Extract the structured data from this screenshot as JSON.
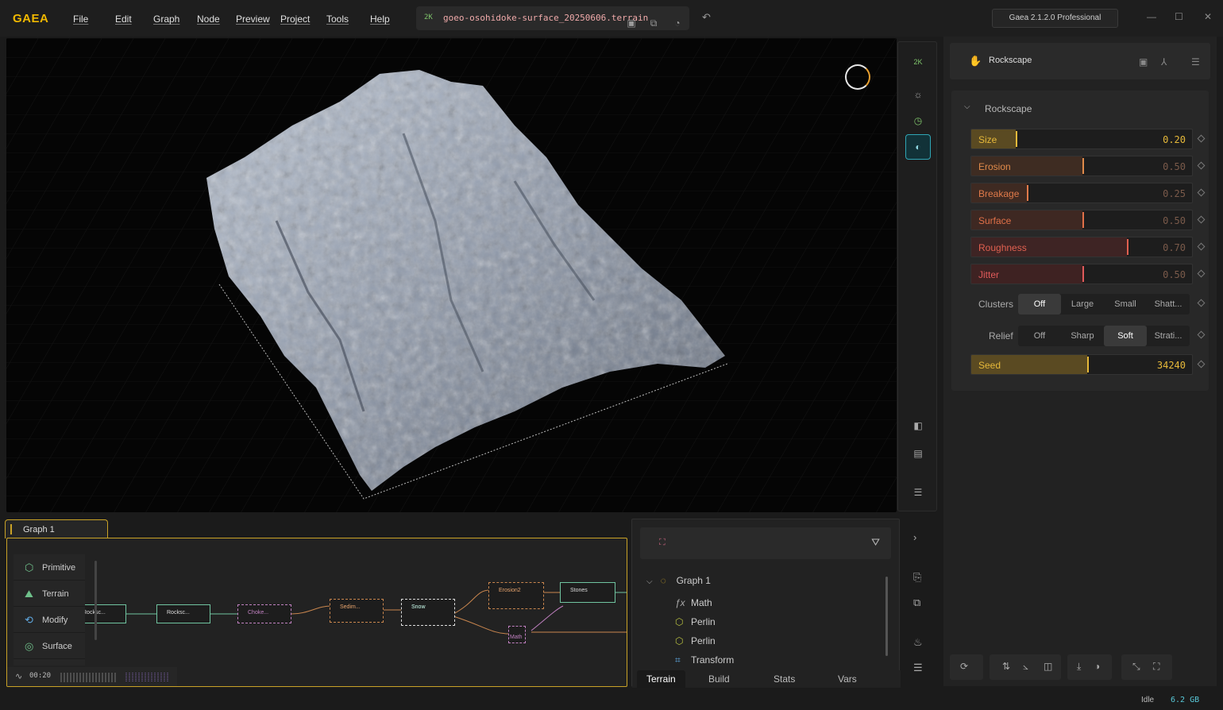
{
  "app": {
    "logo": "GAEA",
    "version": "Gaea 2.1.2.0 Professional"
  },
  "menu": [
    "File",
    "Edit",
    "Graph",
    "Node",
    "Preview",
    "Project",
    "Tools",
    "Help"
  ],
  "file": {
    "resolution": "2K",
    "name": "goeo-osohidoke-surface_20250606.terrain"
  },
  "viewport_tools": {
    "resolution_badge": "2K"
  },
  "properties": {
    "node_name": "Rockscape",
    "section_title": "Rockscape",
    "sliders": [
      {
        "label": "Size",
        "value": "0.20",
        "fraction": 0.2,
        "color": "#e6b93a",
        "fill": "#5a4a22"
      },
      {
        "label": "Erosion",
        "value": "0.50",
        "fraction": 0.5,
        "color": "#e08a4a",
        "fill": "#3e2c22"
      },
      {
        "label": "Breakage",
        "value": "0.25",
        "fraction": 0.25,
        "color": "#e07a4a",
        "fill": "#3e2a22"
      },
      {
        "label": "Surface",
        "value": "0.50",
        "fraction": 0.5,
        "color": "#e07048",
        "fill": "#3e2822"
      },
      {
        "label": "Roughness",
        "value": "0.70",
        "fraction": 0.7,
        "color": "#e06050",
        "fill": "#3e2424"
      },
      {
        "label": "Jitter",
        "value": "0.50",
        "fraction": 0.5,
        "color": "#e05a5a",
        "fill": "#3e2222"
      }
    ],
    "clusters": {
      "label": "Clusters",
      "options": [
        "Off",
        "Large",
        "Small",
        "Shatt..."
      ],
      "selected": "Off"
    },
    "relief": {
      "label": "Relief",
      "options": [
        "Off",
        "Sharp",
        "Soft",
        "Strati..."
      ],
      "selected": "Soft"
    },
    "seed": {
      "label": "Seed",
      "value": "34240",
      "fraction": 0.52,
      "color": "#e6b93a",
      "fill": "#5a4a22"
    }
  },
  "graph": {
    "tab": "Graph 1",
    "palette": [
      {
        "label": "Primitive",
        "icon": "cube-icon"
      },
      {
        "label": "Terrain",
        "icon": "mountain-icon"
      },
      {
        "label": "Modify",
        "icon": "refresh-icon"
      },
      {
        "label": "Surface",
        "icon": "surface-icon"
      }
    ],
    "timer": "00:20",
    "nodes": [
      "Rocksc...",
      "Rocksc...",
      "Choke...",
      "Sedim...",
      "Snow",
      "Erosion2",
      "Stones",
      "Math"
    ]
  },
  "explorer": {
    "root": "Graph 1",
    "items": [
      {
        "label": "Math",
        "icon": "function-icon"
      },
      {
        "label": "Perlin",
        "icon": "hexagon-icon"
      },
      {
        "label": "Perlin",
        "icon": "hexagon-icon"
      },
      {
        "label": "Transform",
        "icon": "transform-icon"
      }
    ],
    "tabs": [
      "Terrain",
      "Build",
      "Stats",
      "Vars"
    ],
    "active_tab": "Terrain"
  },
  "status": {
    "state": "Idle",
    "memory": "6.2 GB"
  }
}
